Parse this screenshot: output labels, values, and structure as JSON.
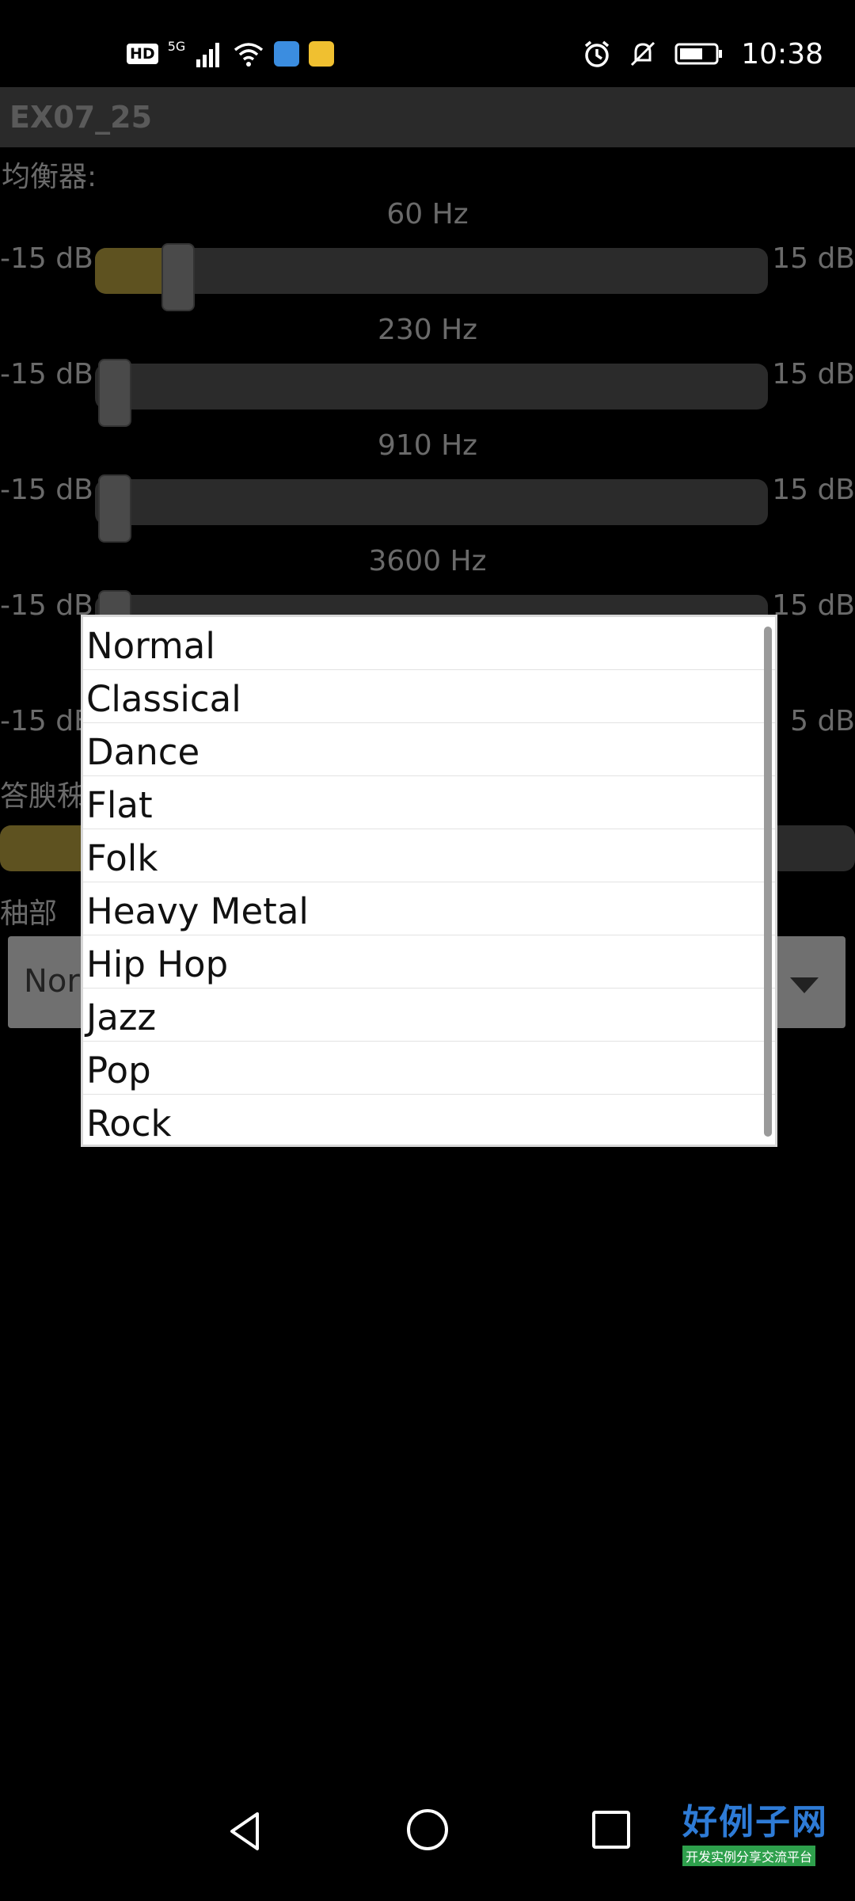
{
  "status_bar": {
    "network_badge": "HD",
    "network_type": "5G",
    "time": "10:38",
    "icons": [
      "hd-icon",
      "signal-icon",
      "wifi-icon",
      "app-icon",
      "mail-icon",
      "alarm-icon",
      "mute-icon",
      "battery-icon"
    ]
  },
  "app": {
    "title": "EX07_25",
    "equalizer_label": "均衡器:",
    "bands": [
      {
        "freq": "60 Hz",
        "min": "-15 dB",
        "max": "15 dB",
        "level_fraction": 0.12
      },
      {
        "freq": "230 Hz",
        "min": "-15 dB",
        "max": "15 dB",
        "level_fraction": 0.0
      },
      {
        "freq": "910 Hz",
        "min": "-15 dB",
        "max": "15 dB",
        "level_fraction": 0.0
      },
      {
        "freq": "3600 Hz",
        "min": "-15 dB",
        "max": "15 dB",
        "level_fraction": 0.0
      },
      {
        "freq": "",
        "min": "-15 dB",
        "max": "5 dB",
        "level_fraction": 0.0
      }
    ],
    "bass_label": "答腴秭",
    "bass_level_fraction": 0.11,
    "preset_label": "秞部",
    "preset_value_partial": "Nor"
  },
  "preset_dialog": {
    "options": [
      "Normal",
      "Classical",
      "Dance",
      "Flat",
      "Folk",
      "Heavy Metal",
      "Hip Hop",
      "Jazz",
      "Pop",
      "Rock"
    ]
  },
  "nav": {
    "brand_main": "好例子网",
    "brand_sub": "开发实例分享交流平台"
  }
}
